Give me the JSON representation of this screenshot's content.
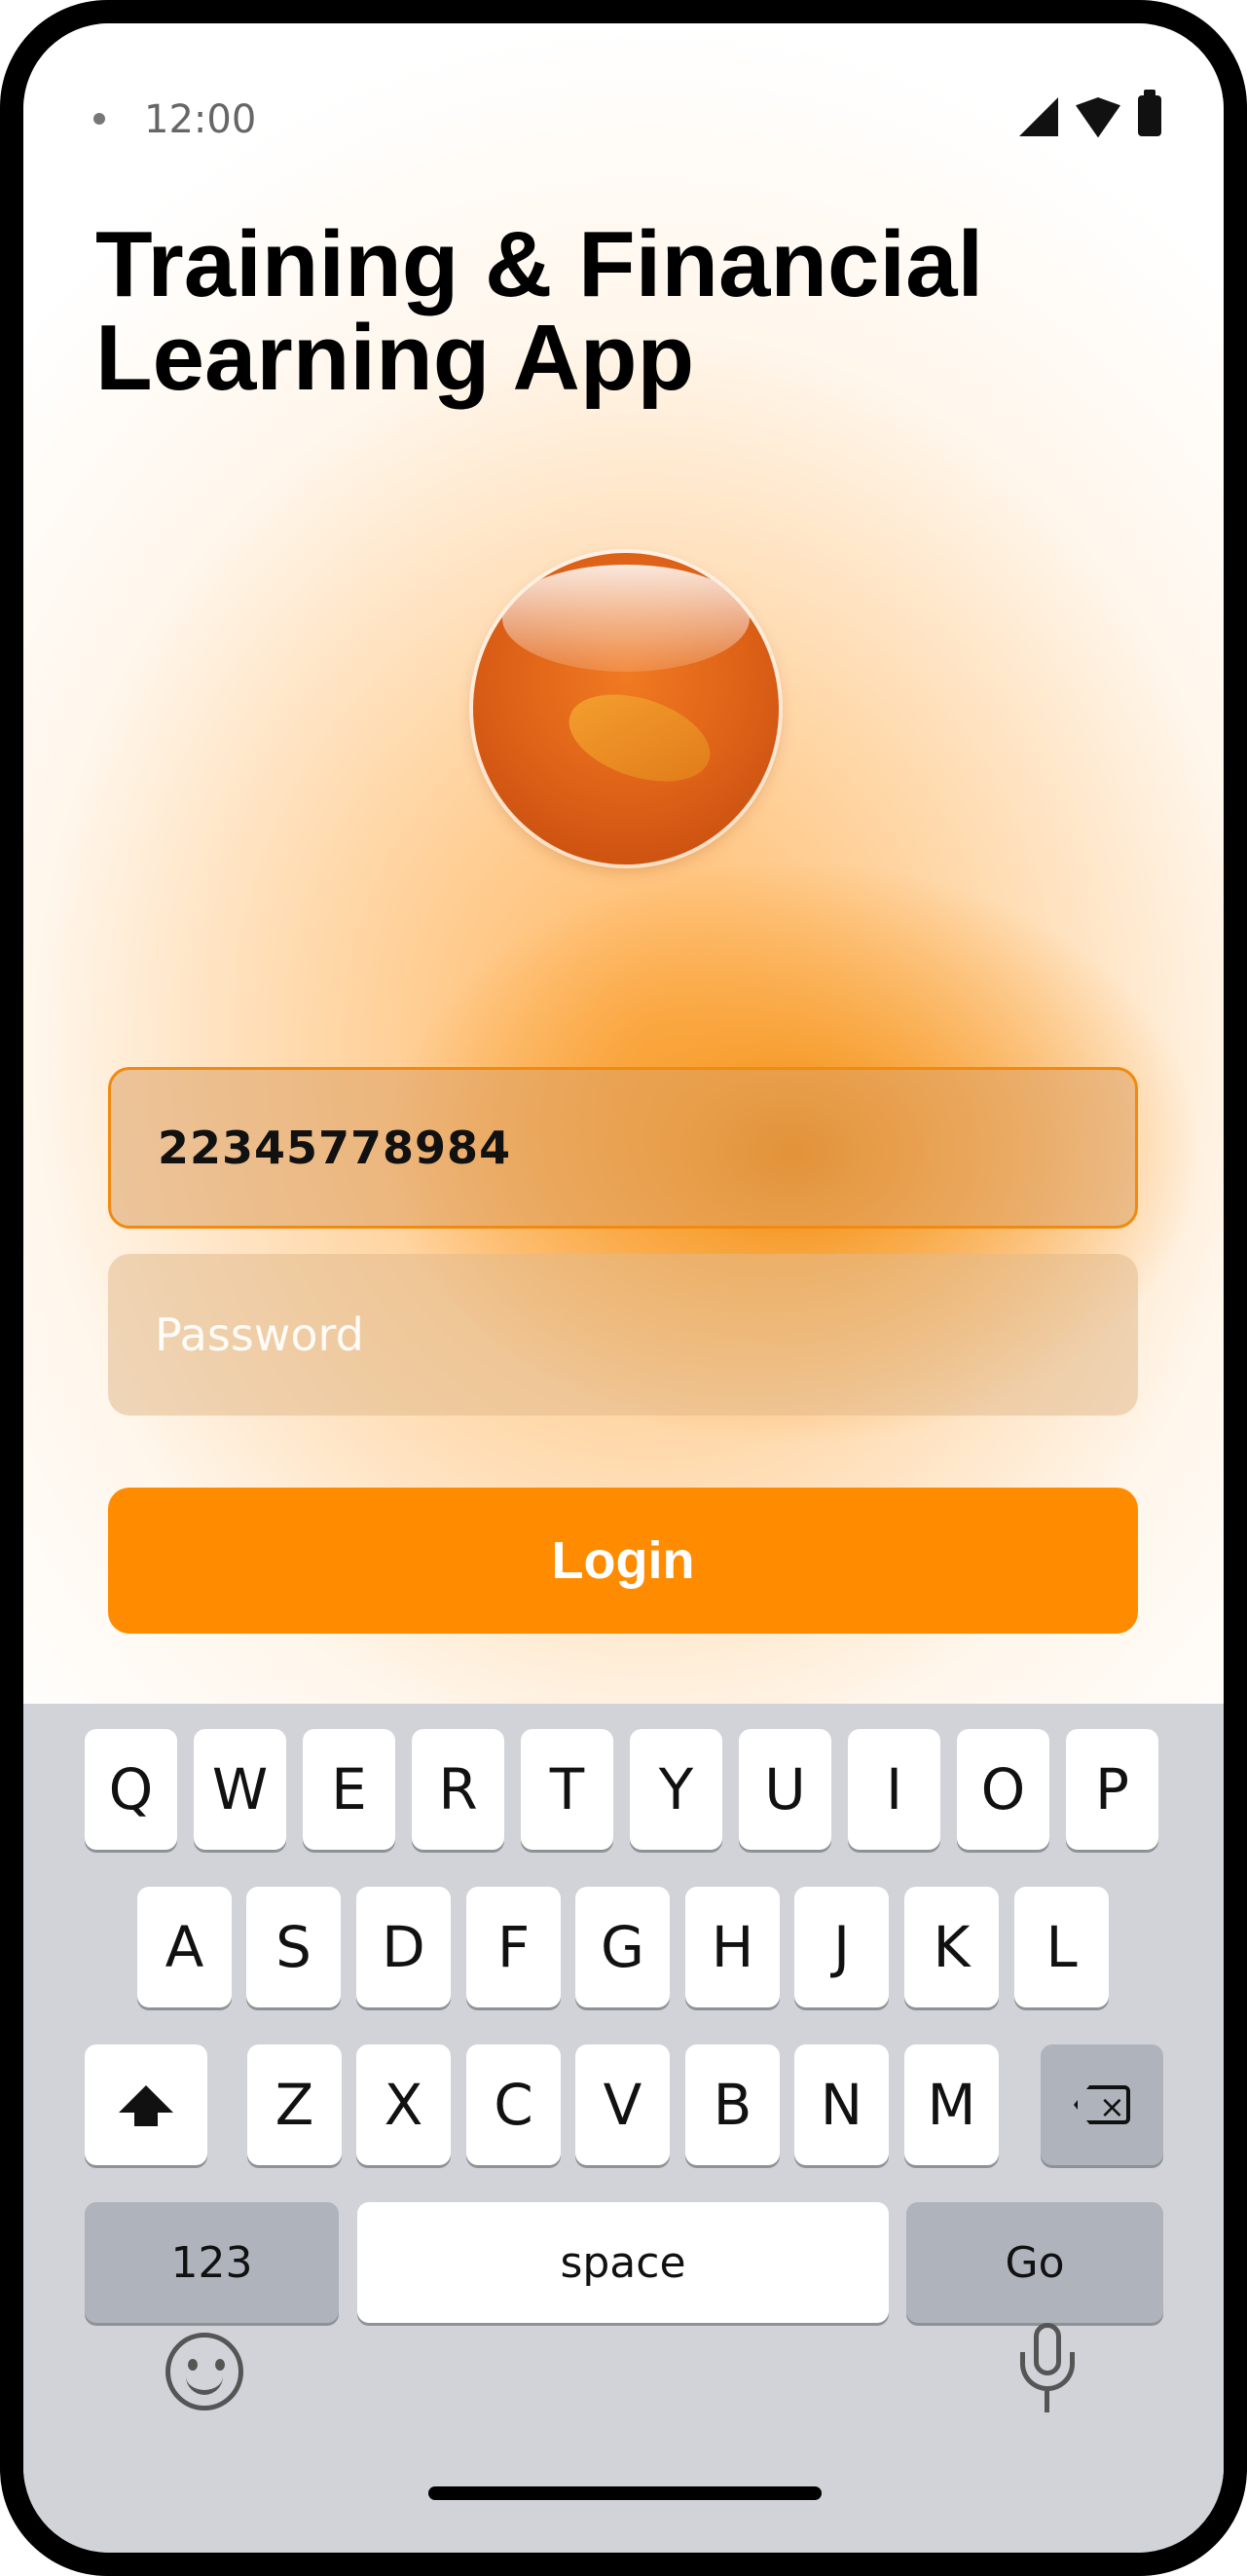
{
  "status_bar": {
    "time": "12:00",
    "icons": [
      "signal-icon",
      "wifi-icon",
      "battery-icon"
    ]
  },
  "app": {
    "title": "Training & Financial Learning App",
    "logo": "orange-sphere-logo"
  },
  "form": {
    "phone_value": "22345778984",
    "password_placeholder": "Password",
    "login_label": "Login"
  },
  "keyboard": {
    "row1": [
      "Q",
      "W",
      "E",
      "R",
      "T",
      "Y",
      "U",
      "I",
      "O",
      "P"
    ],
    "row2": [
      "A",
      "S",
      "D",
      "F",
      "G",
      "H",
      "J",
      "K",
      "L"
    ],
    "row3": [
      "Z",
      "X",
      "C",
      "V",
      "B",
      "N",
      "M"
    ],
    "numbers_label": "123",
    "space_label": "space",
    "go_label": "Go",
    "icons": [
      "shift-icon",
      "backspace-icon",
      "emoji-icon",
      "microphone-icon"
    ]
  },
  "colors": {
    "accent": "#ff8c00",
    "field_border": "#f08a10",
    "keyboard_bg": "#d1d3d8"
  }
}
